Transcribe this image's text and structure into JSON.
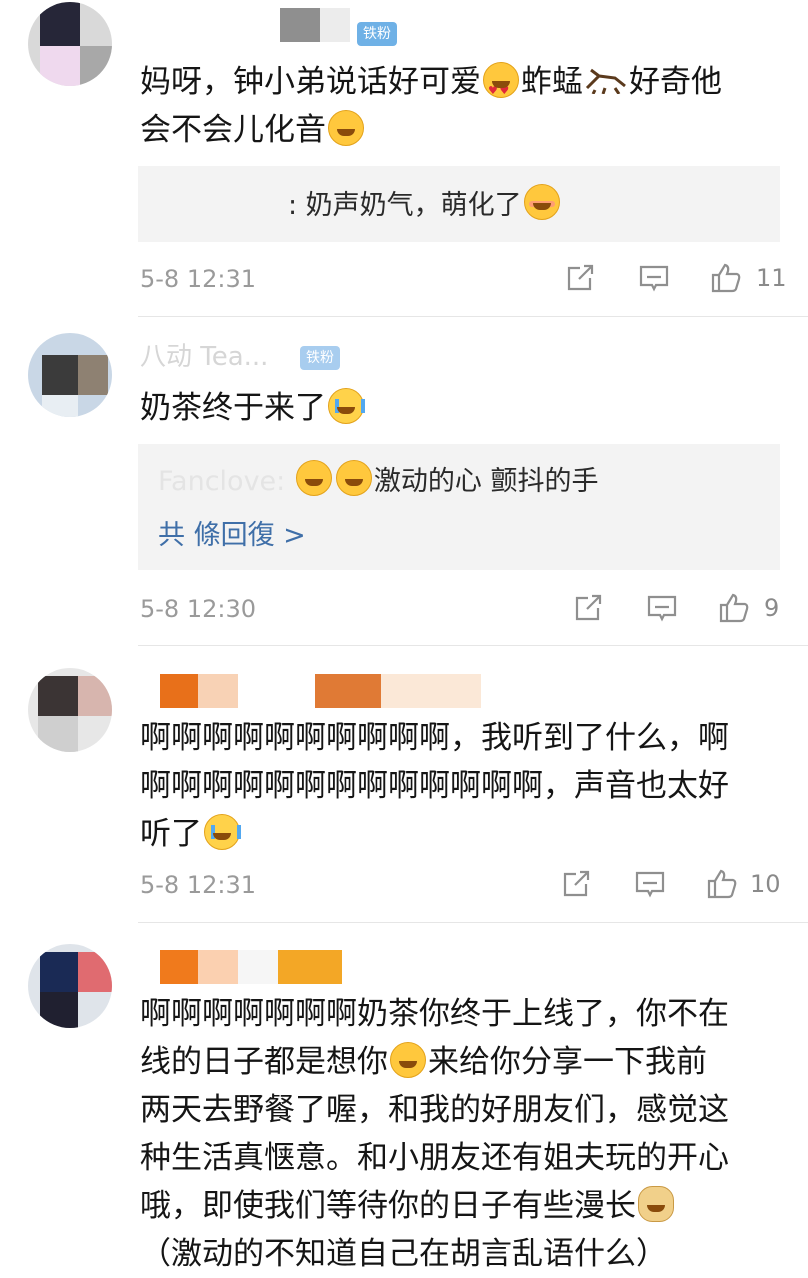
{
  "comments": [
    {
      "username": "...",
      "badge": "铁粉",
      "text_line1": "妈呀，钟小弟说话好可爱",
      "text_mid1": "蚱蜢",
      "text_mid2": "好奇他",
      "text_line2": "会不会儿化音",
      "reply_name": "",
      "reply_text": ": 奶声奶气，萌化了",
      "time": "5-8 12:31",
      "likes": "11"
    },
    {
      "username": "八动 Tea...",
      "badge": "铁粉",
      "text": "奶茶终于来了",
      "reply_name": "Fanclove",
      "reply_text": "激动的心 颤抖的手",
      "reply_more": "共  條回復 >",
      "time": "5-8 12:30",
      "likes": "9"
    },
    {
      "text_line1": "啊啊啊啊啊啊啊啊啊啊，我听到了什么，啊",
      "text_line2": "啊啊啊啊啊啊啊啊啊啊啊啊啊，声音也太好",
      "text_line3": "听了",
      "time": "5-8 12:31",
      "likes": "10"
    },
    {
      "text_line1": "啊啊啊啊啊啊啊奶茶你终于上线了，你不在",
      "text_line2a": "线的日子都是想你",
      "text_line2b": "来给你分享一下我前",
      "text_line3": "两天去野餐了喔，和我的好朋友们，感觉这",
      "text_line4": "种生活真惬意。和小朋友还有姐夫玩的开心",
      "text_line5": "哦，即使我们等待你的日子有些漫长",
      "text_line6": "（激动的不知道自己在胡言乱语什么）"
    }
  ],
  "icons": [
    "share-icon",
    "comment-icon",
    "like-icon"
  ]
}
